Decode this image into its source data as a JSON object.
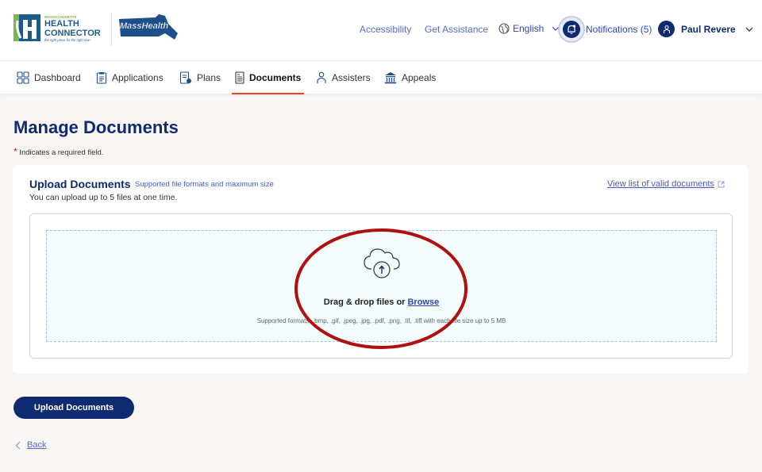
{
  "header": {
    "logo_health_connector": {
      "top": "MASSACHUSETTS",
      "line1": "HEALTH",
      "line2": "CONNECTOR",
      "tagline": "the right place for the right plan"
    },
    "logo_masshealth": "MassHealth",
    "links": {
      "accessibility": "Accessibility",
      "get_assistance": "Get Assistance"
    },
    "language": "English",
    "notifications": "Notifications (5)",
    "user_name": "Paul Revere"
  },
  "nav": {
    "items": [
      {
        "label": "Dashboard",
        "icon": "grid-icon"
      },
      {
        "label": "Applications",
        "icon": "clipboard-icon"
      },
      {
        "label": "Plans",
        "icon": "plan-document-icon"
      },
      {
        "label": "Documents",
        "icon": "document-icon",
        "active": true
      },
      {
        "label": "Assisters",
        "icon": "person-icon"
      },
      {
        "label": "Appeals",
        "icon": "courthouse-icon"
      }
    ]
  },
  "main": {
    "title": "Manage Documents",
    "required_star": "*",
    "required_note": "Indicates a required field.",
    "upload_card": {
      "title": "Upload Documents",
      "subtitle": "Supported file formats and maximum size",
      "description": "You can upload up to 5 files at one time.",
      "valid_docs_link": "View list of valid documents",
      "drag_text": "Drag & drop files or",
      "browse_label": "Browse",
      "formats_note": "Supported formats: .bmp, .gif, .jpeg, .jpg, .pdf, .png, .tif, .tiff with each file size up to 5 MB"
    },
    "upload_button": "Upload Documents",
    "back_label": "Back"
  },
  "colors": {
    "brand_navy": "#0e2a70",
    "link_blue": "#4a5bc4",
    "active_tab_underline": "#e8452a",
    "required_red": "#c8102e",
    "annotation_red": "#b01010",
    "dropzone_bg": "#f3fcfc"
  }
}
